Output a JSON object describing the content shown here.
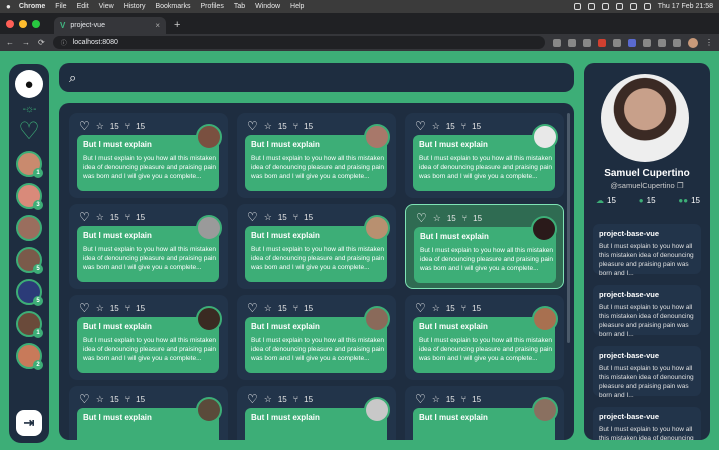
{
  "menubar": {
    "app": "Chrome",
    "items": [
      "File",
      "Edit",
      "View",
      "History",
      "Bookmarks",
      "Profiles",
      "Tab",
      "Window",
      "Help"
    ],
    "clock": "Thu 17 Feb  21:58"
  },
  "browser": {
    "tab_title": "project-vue",
    "url": "localhost:8080",
    "tab_close": "×",
    "new_tab": "+",
    "nav_back": "←",
    "nav_forward": "→",
    "nav_reload": "⟳",
    "menu_dots": "⋮"
  },
  "sidebar": {
    "github_glyph": "●",
    "heart_glyph": "♡",
    "logout_glyph": "⇥",
    "avatars": [
      {
        "color": "#c98a6e",
        "badge": "1"
      },
      {
        "color": "#d98a7a",
        "badge": "3"
      },
      {
        "color": "#9a6e5e",
        "badge": ""
      },
      {
        "color": "#7a5a4a",
        "badge": "5"
      },
      {
        "color": "#2b3b78",
        "badge": "5"
      },
      {
        "color": "#6a4a3a",
        "badge": "1"
      },
      {
        "color": "#c87a5a",
        "badge": "2"
      }
    ]
  },
  "search": {
    "placeholder": ""
  },
  "cards": [
    {
      "stars": "15",
      "forks": "15",
      "title": "But I must explain",
      "body": "But I must explain to you how all this mistaken idea of denouncing pleasure and praising pain was born and I will give you a complete...",
      "avatar_color": "#7a5040"
    },
    {
      "stars": "15",
      "forks": "15",
      "title": "But I must explain",
      "body": "But I must explain to you how all this mistaken idea of denouncing pleasure and praising pain was born and I will give you a complete...",
      "avatar_color": "#a8786a"
    },
    {
      "stars": "15",
      "forks": "15",
      "title": "But I must explain",
      "body": "But I must explain to you how all this mistaken idea of denouncing pleasure and praising pain was born and I will give you a complete...",
      "avatar_color": "#e8e8e8"
    },
    {
      "stars": "15",
      "forks": "15",
      "title": "But I must explain",
      "body": "But I must explain to you how all this mistaken idea of denouncing pleasure and praising pain was born and I will give you a complete...",
      "avatar_color": "#9a9a9a"
    },
    {
      "stars": "15",
      "forks": "15",
      "title": "But I must explain",
      "body": "But I must explain to you how all this mistaken idea of denouncing pleasure and praising pain was born and I will give you a complete...",
      "avatar_color": "#b89070"
    },
    {
      "stars": "15",
      "forks": "15",
      "title": "But I must explain",
      "body": "But I must explain to you how all this mistaken idea of denouncing pleasure and praising pain was born and I will give you a complete...",
      "avatar_color": "#2a1a1a"
    },
    {
      "stars": "15",
      "forks": "15",
      "title": "But I must explain",
      "body": "But I must explain to you how all this mistaken idea of denouncing pleasure and praising pain was born and I will give you a complete...",
      "avatar_color": "#3a2a22"
    },
    {
      "stars": "15",
      "forks": "15",
      "title": "But I must explain",
      "body": "But I must explain to you how all this mistaken idea of denouncing pleasure and praising pain was born and I will give you a complete...",
      "avatar_color": "#8a6a5a"
    },
    {
      "stars": "15",
      "forks": "15",
      "title": "But I must explain",
      "body": "But I must explain to you how all this mistaken idea of denouncing pleasure and praising pain was born and I will give you a complete...",
      "avatar_color": "#a87050"
    },
    {
      "stars": "15",
      "forks": "15",
      "title": "But I must explain",
      "body": "",
      "avatar_color": "#5a4a3a"
    },
    {
      "stars": "15",
      "forks": "15",
      "title": "But I must explain",
      "body": "",
      "avatar_color": "#c8c8c8"
    },
    {
      "stars": "15",
      "forks": "15",
      "title": "But I must explain",
      "body": "",
      "avatar_color": "#8a7060"
    }
  ],
  "profile": {
    "name": "Samuel Cupertino",
    "handle": "@samuelCupertino",
    "copy_glyph": "❐",
    "repos": "15",
    "following": "15",
    "followers": "15"
  },
  "repos": [
    {
      "title": "project-base-vue",
      "body": "But I must explain to you how all this mistaken idea of denouncing pleasure and praising pain was born and I..."
    },
    {
      "title": "project-base-vue",
      "body": "But I must explain to you how all this mistaken idea of denouncing pleasure and praising pain was born and I..."
    },
    {
      "title": "project-base-vue",
      "body": "But I must explain to you how all this mistaken idea of denouncing pleasure and praising pain was born and I..."
    },
    {
      "title": "project-base-vue",
      "body": "But I must explain to you how all this mistaken idea of denouncing pleasure and praising pain was born and I..."
    }
  ],
  "colors": {
    "accent": "#3dae77",
    "panel": "#1e2d40",
    "card": "#22344a"
  }
}
